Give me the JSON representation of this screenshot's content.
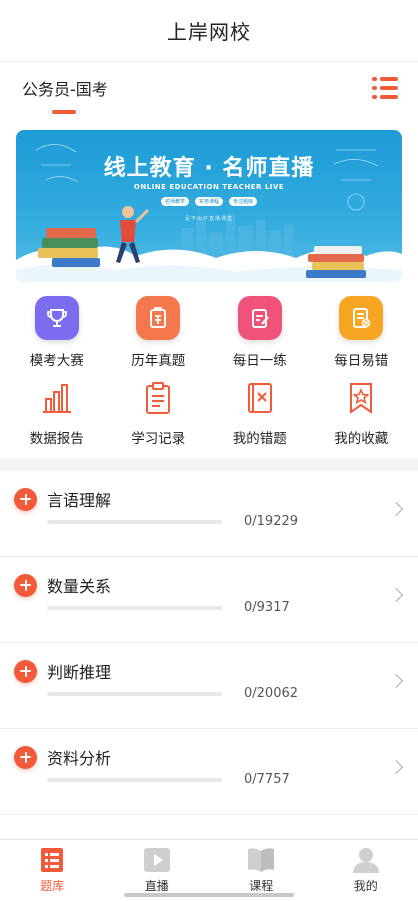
{
  "header": {
    "title": "上岸网校"
  },
  "exam": {
    "selected": "公务员-国考"
  },
  "banner": {
    "title": "线上教育 · 名师直播",
    "subtitle": "ONLINE EDUCATION TEACHER LIVE",
    "pills": [
      "名师教学",
      "实务课程",
      "专注题库"
    ],
    "footer": "足不出户直播课堂"
  },
  "quick_actions": [
    {
      "label": "模考大赛",
      "icon": "trophy-icon",
      "color": "#7b6cf0"
    },
    {
      "label": "历年真题",
      "icon": "exam-paper-icon",
      "color": "#f4774e"
    },
    {
      "label": "每日一练",
      "icon": "daily-practice-icon",
      "color": "#f0527a"
    },
    {
      "label": "每日易错",
      "icon": "mistake-doc-icon",
      "color": "#f6a623"
    }
  ],
  "tools": [
    {
      "label": "数据报告",
      "icon": "bar-chart-icon"
    },
    {
      "label": "学习记录",
      "icon": "clipboard-icon"
    },
    {
      "label": "我的错题",
      "icon": "wrong-book-icon"
    },
    {
      "label": "我的收藏",
      "icon": "bookmark-star-icon"
    }
  ],
  "categories": [
    {
      "name": "言语理解",
      "count": "0/19229",
      "progress": 0
    },
    {
      "name": "数量关系",
      "count": "0/9317",
      "progress": 0
    },
    {
      "name": "判断推理",
      "count": "0/20062",
      "progress": 0
    },
    {
      "name": "资料分析",
      "count": "0/7757",
      "progress": 0
    }
  ],
  "tabbar": {
    "items": [
      {
        "label": "题库",
        "icon": "question-bank-icon",
        "active": true
      },
      {
        "label": "直播",
        "icon": "live-play-icon",
        "active": false
      },
      {
        "label": "课程",
        "icon": "course-book-icon",
        "active": false
      },
      {
        "label": "我的",
        "icon": "user-icon",
        "active": false
      }
    ]
  },
  "colors": {
    "accent": "#f25a3a",
    "banner": "#1d9bd6"
  }
}
